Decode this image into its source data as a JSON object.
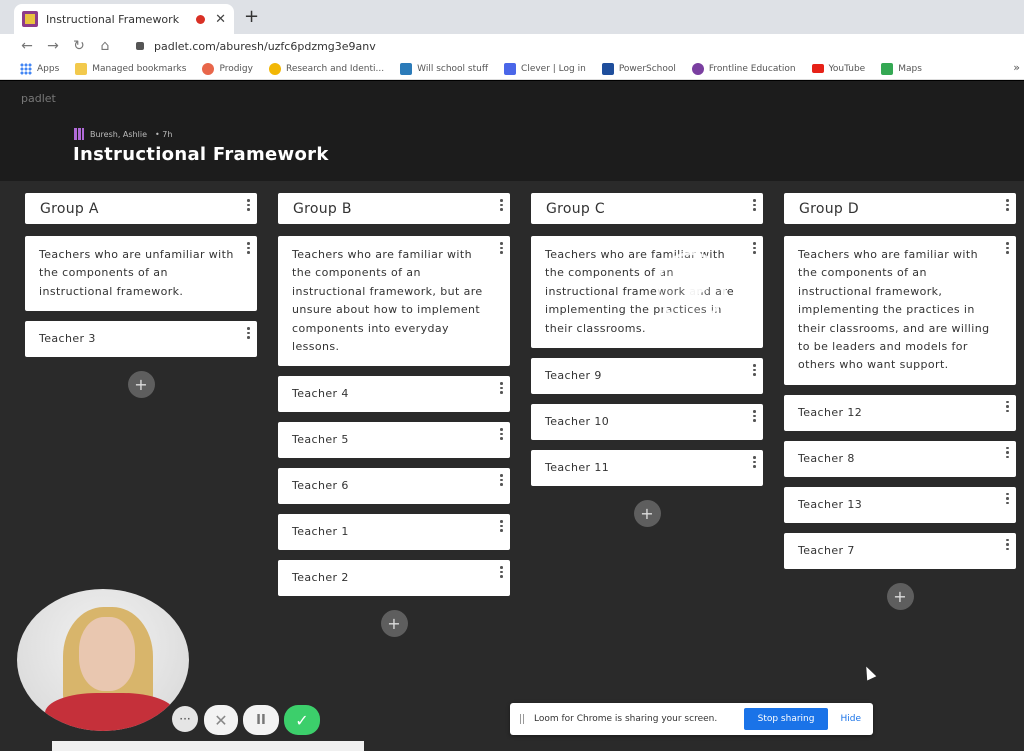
{
  "browser": {
    "tab_title": "Instructional Framework",
    "tab_close": "✕",
    "new_tab": "+",
    "url": "padlet.com/aburesh/uzfc6pdzmg3e9anv",
    "nav": {
      "back": "←",
      "forward": "→",
      "reload": "↻",
      "home": "⌂"
    },
    "bookmarks": [
      {
        "label": "Apps",
        "icon": "apps-grid-icon",
        "color": "#4285f4"
      },
      {
        "label": "Managed bookmarks",
        "icon": "folder-icon",
        "color": "#f2c94c"
      },
      {
        "label": "Prodigy",
        "icon": "prodigy-icon",
        "color": "#e8664a"
      },
      {
        "label": "Research and Identi...",
        "icon": "research-icon",
        "color": "#f2b705"
      },
      {
        "label": "Will school stuff",
        "icon": "r-icon",
        "color": "#2b7bb9"
      },
      {
        "label": "Clever | Log in",
        "icon": "clever-icon",
        "color": "#4a66e8"
      },
      {
        "label": "PowerSchool",
        "icon": "powerschool-icon",
        "color": "#1f4e9c"
      },
      {
        "label": "Frontline Education",
        "icon": "frontline-icon",
        "color": "#7a3fa0"
      },
      {
        "label": "YouTube",
        "icon": "youtube-icon",
        "color": "#e62117"
      },
      {
        "label": "Maps",
        "icon": "maps-icon",
        "color": "#34a853"
      }
    ],
    "bookmarks_more": "»"
  },
  "padlet": {
    "brand": "padlet",
    "author": "Buresh, Ashlie",
    "time": "• 7h",
    "title": "Instructional Framework",
    "add_label": "+",
    "columns": [
      {
        "title": "Group A",
        "description": "Teachers who are unfamiliar with the components of an instructional framework.",
        "teachers": [
          "Teacher 3"
        ]
      },
      {
        "title": "Group B",
        "description": "Teachers who are familiar with the components of an instructional framework, but are unsure about how to implement components into everyday lessons.",
        "teachers": [
          "Teacher 4",
          "Teacher 5",
          "Teacher 6",
          "Teacher 1",
          "Teacher 2"
        ]
      },
      {
        "title": "Group C",
        "description": "Teachers who are familiar with the components of an instructional framework and are implementing the practices in their classrooms.",
        "teachers": [
          "Teacher 9",
          "Teacher 10",
          "Teacher 11"
        ]
      },
      {
        "title": "Group D",
        "description": "Teachers who are familiar with the components of an instructional framework, implementing the practices in their classrooms, and are willing to be leaders and models for others who want support.",
        "teachers": [
          "Teacher 12",
          "Teacher 8",
          "Teacher 13",
          "Teacher 7"
        ]
      }
    ]
  },
  "loom": {
    "more": "···",
    "cancel": "✕",
    "pause": "II",
    "done": "✓",
    "share_text": "Loom for Chrome is sharing your screen.",
    "stop_sharing": "Stop sharing",
    "hide": "Hide"
  }
}
